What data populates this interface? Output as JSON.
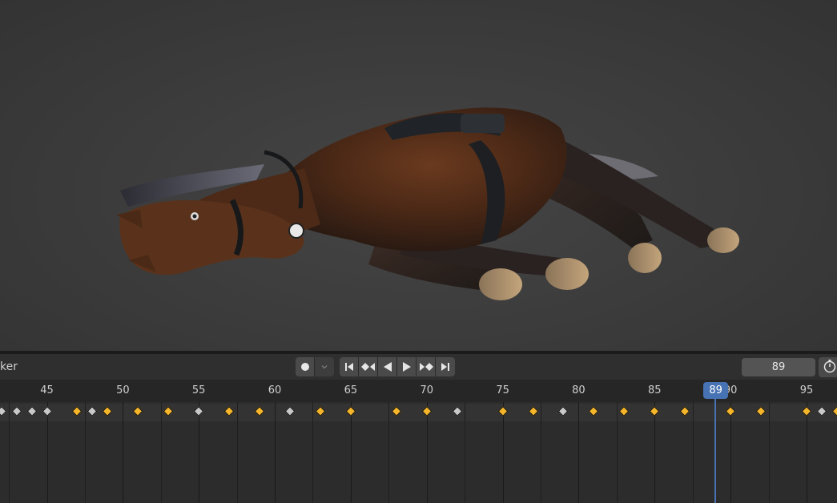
{
  "timeline": {
    "header_label": "ker",
    "current_frame": "89",
    "playhead_badge": "89",
    "playhead_frame": 89
  },
  "ruler": {
    "ticks": [
      "45",
      "50",
      "55",
      "60",
      "65",
      "70",
      "75",
      "80",
      "85",
      "90",
      "95"
    ]
  },
  "keyframes": [
    {
      "frame": 42,
      "type": "breakdown"
    },
    {
      "frame": 43,
      "type": "breakdown"
    },
    {
      "frame": 44,
      "type": "breakdown"
    },
    {
      "frame": 45,
      "type": "breakdown"
    },
    {
      "frame": 47,
      "type": "keyframe"
    },
    {
      "frame": 48,
      "type": "breakdown"
    },
    {
      "frame": 49,
      "type": "keyframe"
    },
    {
      "frame": 51,
      "type": "keyframe"
    },
    {
      "frame": 53,
      "type": "keyframe"
    },
    {
      "frame": 55,
      "type": "breakdown"
    },
    {
      "frame": 57,
      "type": "keyframe"
    },
    {
      "frame": 59,
      "type": "keyframe"
    },
    {
      "frame": 61,
      "type": "breakdown"
    },
    {
      "frame": 63,
      "type": "keyframe"
    },
    {
      "frame": 65,
      "type": "keyframe"
    },
    {
      "frame": 68,
      "type": "keyframe"
    },
    {
      "frame": 70,
      "type": "keyframe"
    },
    {
      "frame": 72,
      "type": "breakdown"
    },
    {
      "frame": 75,
      "type": "keyframe"
    },
    {
      "frame": 77,
      "type": "keyframe"
    },
    {
      "frame": 79,
      "type": "breakdown"
    },
    {
      "frame": 81,
      "type": "keyframe"
    },
    {
      "frame": 83,
      "type": "keyframe"
    },
    {
      "frame": 85,
      "type": "keyframe"
    },
    {
      "frame": 87,
      "type": "keyframe"
    },
    {
      "frame": 90,
      "type": "keyframe"
    },
    {
      "frame": 92,
      "type": "keyframe"
    },
    {
      "frame": 95,
      "type": "keyframe"
    },
    {
      "frame": 96,
      "type": "breakdown"
    },
    {
      "frame": 97,
      "type": "keyframe"
    }
  ],
  "icons": {
    "record": "record-dot-icon",
    "keying_menu": "chevron-down-icon",
    "jump_start": "jump-to-start-icon",
    "prev_key": "previous-keyframe-icon",
    "play_reverse": "play-reverse-icon",
    "play": "play-icon",
    "next_key": "next-keyframe-icon",
    "jump_end": "jump-to-end-icon",
    "timer": "stopwatch-icon"
  },
  "colors": {
    "keyframe": "#f5b62c",
    "breakdown": "#c9c9c9",
    "playhead": "#4772b3",
    "viewport_bg": "#3d3d3d"
  }
}
